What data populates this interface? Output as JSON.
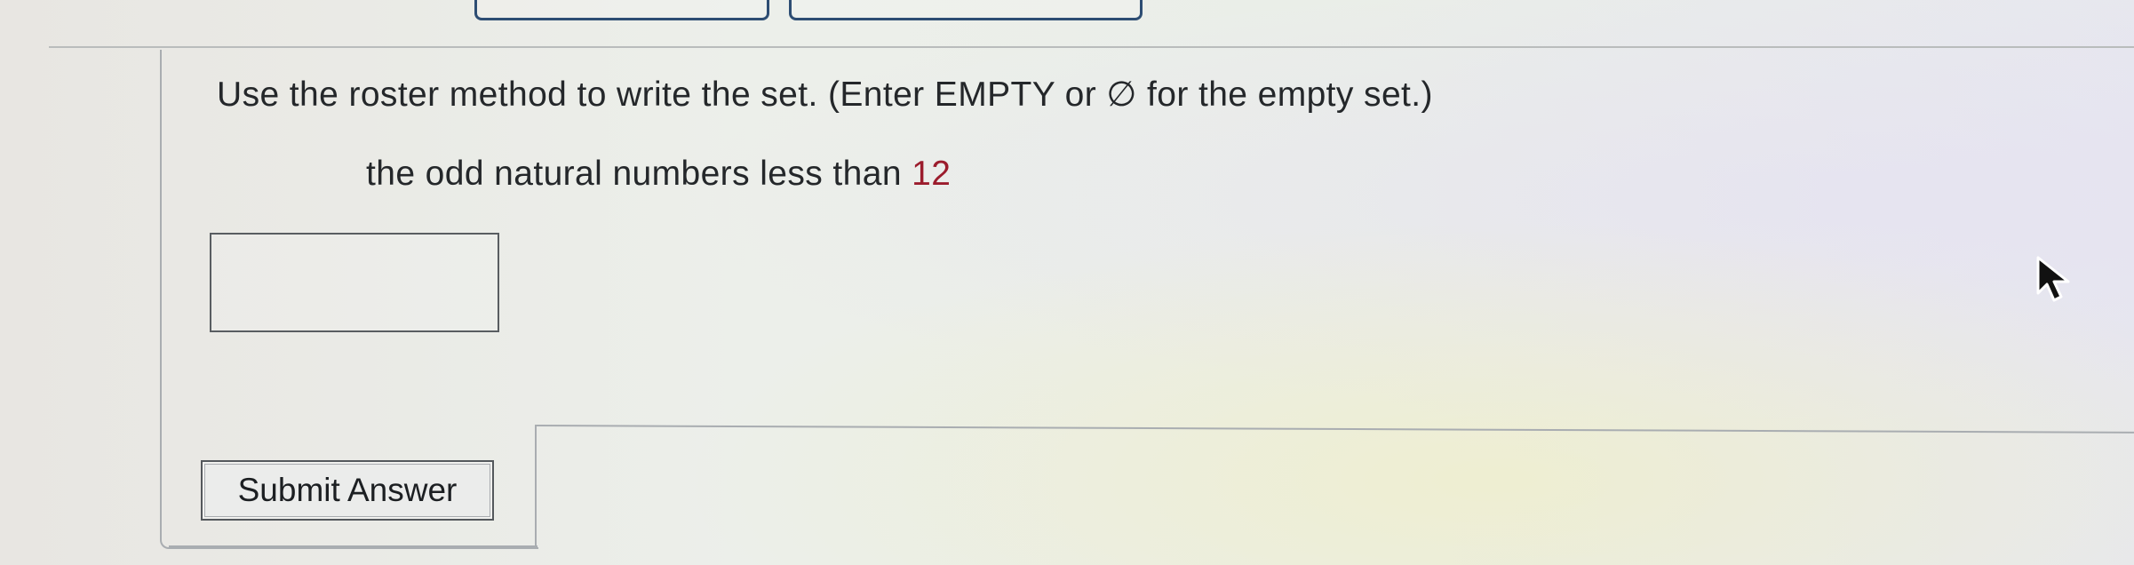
{
  "question": {
    "instructions": "Use the roster method to write the set. (Enter EMPTY or ∅ for the empty set.)",
    "problem_text": "the odd natural numbers less than",
    "problem_number": "12"
  },
  "answer_field": {
    "value": "",
    "placeholder": ""
  },
  "submit": {
    "label": "Submit Answer"
  },
  "icons": {
    "cursor": "mouse-pointer-icon"
  }
}
